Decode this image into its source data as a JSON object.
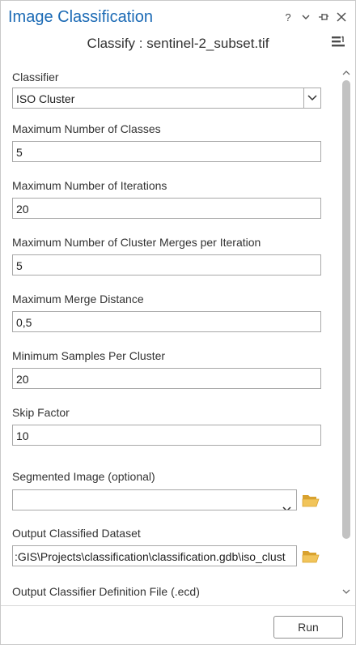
{
  "pane": {
    "title": "Image Classification",
    "subtitle": "Classify : sentinel-2_subset.tif",
    "tools": {
      "help": "?",
      "options": "chevron-down-icon",
      "pin": "pin-icon",
      "close": "close-icon"
    }
  },
  "form": {
    "classifier": {
      "label": "Classifier",
      "value": "ISO Cluster"
    },
    "max_classes": {
      "label": "Maximum Number of Classes",
      "value": "5"
    },
    "max_iterations": {
      "label": "Maximum Number of Iterations",
      "value": "20"
    },
    "max_merges": {
      "label": "Maximum Number of Cluster Merges per Iteration",
      "value": "5"
    },
    "max_merge_distance": {
      "label": "Maximum Merge Distance",
      "value": "0,5"
    },
    "min_samples": {
      "label": "Minimum Samples Per Cluster",
      "value": "20"
    },
    "skip_factor": {
      "label": "Skip Factor",
      "value": "10"
    },
    "segmented_image": {
      "label": "Segmented Image (optional)",
      "value": ""
    },
    "output_dataset": {
      "label": "Output Classified Dataset",
      "value": ":GIS\\Projects\\classification\\classification.gdb\\iso_clust"
    },
    "output_ecd": {
      "label": "Output Classifier Definition File (.ecd)"
    }
  },
  "footer": {
    "run_label": "Run"
  },
  "colors": {
    "title": "#1b6ab5",
    "folder": "#e8b84a",
    "scroll_thumb": "#c2c2c2"
  }
}
